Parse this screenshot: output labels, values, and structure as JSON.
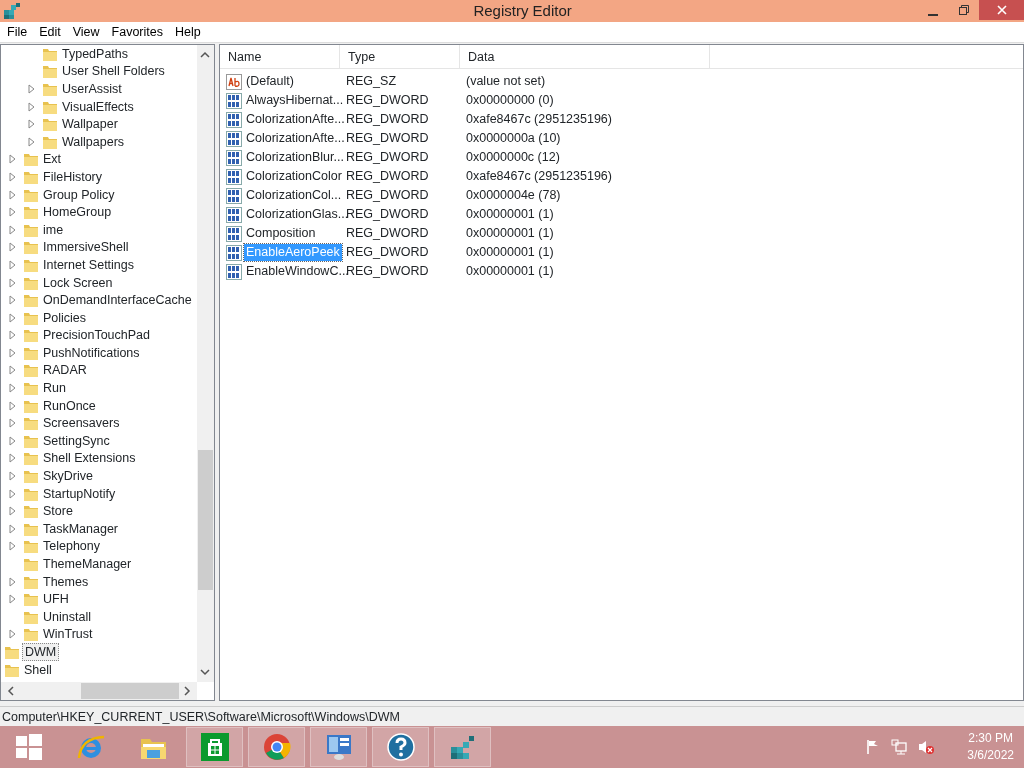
{
  "window": {
    "title": "Registry Editor"
  },
  "menu": [
    "File",
    "Edit",
    "View",
    "Favorites",
    "Help"
  ],
  "tree": {
    "items": [
      {
        "children": [
          {
            "children": [
              {
                "label": "TypedPaths",
                "expandable": false,
                "selected": false
              },
              {
                "label": "User Shell Folders",
                "expandable": false,
                "selected": false
              },
              {
                "label": "UserAssist",
                "expandable": true,
                "selected": false
              },
              {
                "label": "VisualEffects",
                "expandable": true,
                "selected": false
              },
              {
                "label": "Wallpaper",
                "expandable": true,
                "selected": false
              },
              {
                "label": "Wallpapers",
                "expandable": true,
                "selected": false
              }
            ]
          },
          {
            "label": "Ext",
            "expandable": true,
            "selected": false
          },
          {
            "label": "FileHistory",
            "expandable": true,
            "selected": false
          },
          {
            "label": "Group Policy",
            "expandable": true,
            "selected": false
          },
          {
            "label": "HomeGroup",
            "expandable": true,
            "selected": false
          },
          {
            "label": "ime",
            "expandable": true,
            "selected": false
          },
          {
            "label": "ImmersiveShell",
            "expandable": true,
            "selected": false
          },
          {
            "label": "Internet Settings",
            "expandable": true,
            "selected": false
          },
          {
            "label": "Lock Screen",
            "expandable": true,
            "selected": false
          },
          {
            "label": "OnDemandInterfaceCache",
            "expandable": true,
            "selected": false
          },
          {
            "label": "Policies",
            "expandable": true,
            "selected": false
          },
          {
            "label": "PrecisionTouchPad",
            "expandable": true,
            "selected": false
          },
          {
            "label": "PushNotifications",
            "expandable": true,
            "selected": false
          },
          {
            "label": "RADAR",
            "expandable": true,
            "selected": false
          },
          {
            "label": "Run",
            "expandable": true,
            "selected": false
          },
          {
            "label": "RunOnce",
            "expandable": true,
            "selected": false
          },
          {
            "label": "Screensavers",
            "expandable": true,
            "selected": false
          },
          {
            "label": "SettingSync",
            "expandable": true,
            "selected": false
          },
          {
            "label": "Shell Extensions",
            "expandable": true,
            "selected": false
          },
          {
            "label": "SkyDrive",
            "expandable": true,
            "selected": false
          },
          {
            "label": "StartupNotify",
            "expandable": true,
            "selected": false
          },
          {
            "label": "Store",
            "expandable": true,
            "selected": false
          },
          {
            "label": "TaskManager",
            "expandable": true,
            "selected": false
          },
          {
            "label": "Telephony",
            "expandable": true,
            "selected": false
          },
          {
            "label": "ThemeManager",
            "expandable": false,
            "selected": false
          },
          {
            "label": "Themes",
            "expandable": true,
            "selected": false
          },
          {
            "label": "UFH",
            "expandable": true,
            "selected": false
          },
          {
            "label": "Uninstall",
            "expandable": false,
            "selected": false
          },
          {
            "label": "WinTrust",
            "expandable": true,
            "selected": false
          }
        ]
      },
      {
        "label": "DWM",
        "selected": true
      },
      {
        "label": "Shell",
        "selected": false
      }
    ]
  },
  "values": {
    "columns": [
      "Name",
      "Type",
      "Data"
    ],
    "rows": [
      {
        "kind": "string",
        "name": "(Default)",
        "type": "REG_SZ",
        "data": "(value not set)",
        "selected": false
      },
      {
        "kind": "dword",
        "name": "AlwaysHibernat...",
        "type": "REG_DWORD",
        "data": "0x00000000 (0)",
        "selected": false
      },
      {
        "kind": "dword",
        "name": "ColorizationAfte...",
        "type": "REG_DWORD",
        "data": "0xafe8467c (2951235196)",
        "selected": false
      },
      {
        "kind": "dword",
        "name": "ColorizationAfte...",
        "type": "REG_DWORD",
        "data": "0x0000000a (10)",
        "selected": false
      },
      {
        "kind": "dword",
        "name": "ColorizationBlur...",
        "type": "REG_DWORD",
        "data": "0x0000000c (12)",
        "selected": false
      },
      {
        "kind": "dword",
        "name": "ColorizationColor",
        "type": "REG_DWORD",
        "data": "0xafe8467c (2951235196)",
        "selected": false
      },
      {
        "kind": "dword",
        "name": "ColorizationCol...",
        "type": "REG_DWORD",
        "data": "0x0000004e (78)",
        "selected": false
      },
      {
        "kind": "dword",
        "name": "ColorizationGlas...",
        "type": "REG_DWORD",
        "data": "0x00000001 (1)",
        "selected": false
      },
      {
        "kind": "dword",
        "name": "Composition",
        "type": "REG_DWORD",
        "data": "0x00000001 (1)",
        "selected": false
      },
      {
        "kind": "dword",
        "name": "EnableAeroPeek",
        "type": "REG_DWORD",
        "data": "0x00000001 (1)",
        "selected": true
      },
      {
        "kind": "dword",
        "name": "EnableWindowC...",
        "type": "REG_DWORD",
        "data": "0x00000001 (1)",
        "selected": false
      }
    ]
  },
  "status_bar": {
    "path": "Computer\\HKEY_CURRENT_USER\\Software\\Microsoft\\Windows\\DWM"
  },
  "taskbar": {
    "items": [
      {
        "kind": "start",
        "running": false
      },
      {
        "kind": "browser-e",
        "running": false
      },
      {
        "kind": "folder",
        "running": false
      },
      {
        "kind": "store",
        "running": true
      },
      {
        "kind": "chrome",
        "running": true
      },
      {
        "kind": "panel",
        "running": true
      },
      {
        "kind": "help",
        "running": true
      },
      {
        "kind": "cubes",
        "running": true
      }
    ],
    "clock": {
      "time": "2:30 PM",
      "date": "3/6/2022"
    }
  }
}
